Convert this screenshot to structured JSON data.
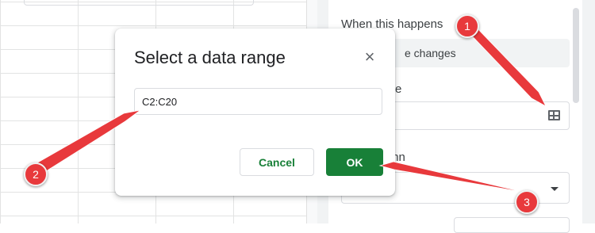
{
  "sheet": {},
  "panel": {
    "when_label": "When this happens",
    "trigger_value": "e changes",
    "range_label_partial": "e",
    "column_label_partial": "mn"
  },
  "dialog": {
    "title": "Select a data range",
    "close_icon": "×",
    "range_value": "C2:C20",
    "cancel_label": "Cancel",
    "ok_label": "OK"
  },
  "annotations": {
    "color": "#e8393c",
    "badges": [
      "1",
      "2",
      "3"
    ]
  },
  "colors": {
    "accent": "#188038",
    "annotation": "#e8393c"
  }
}
